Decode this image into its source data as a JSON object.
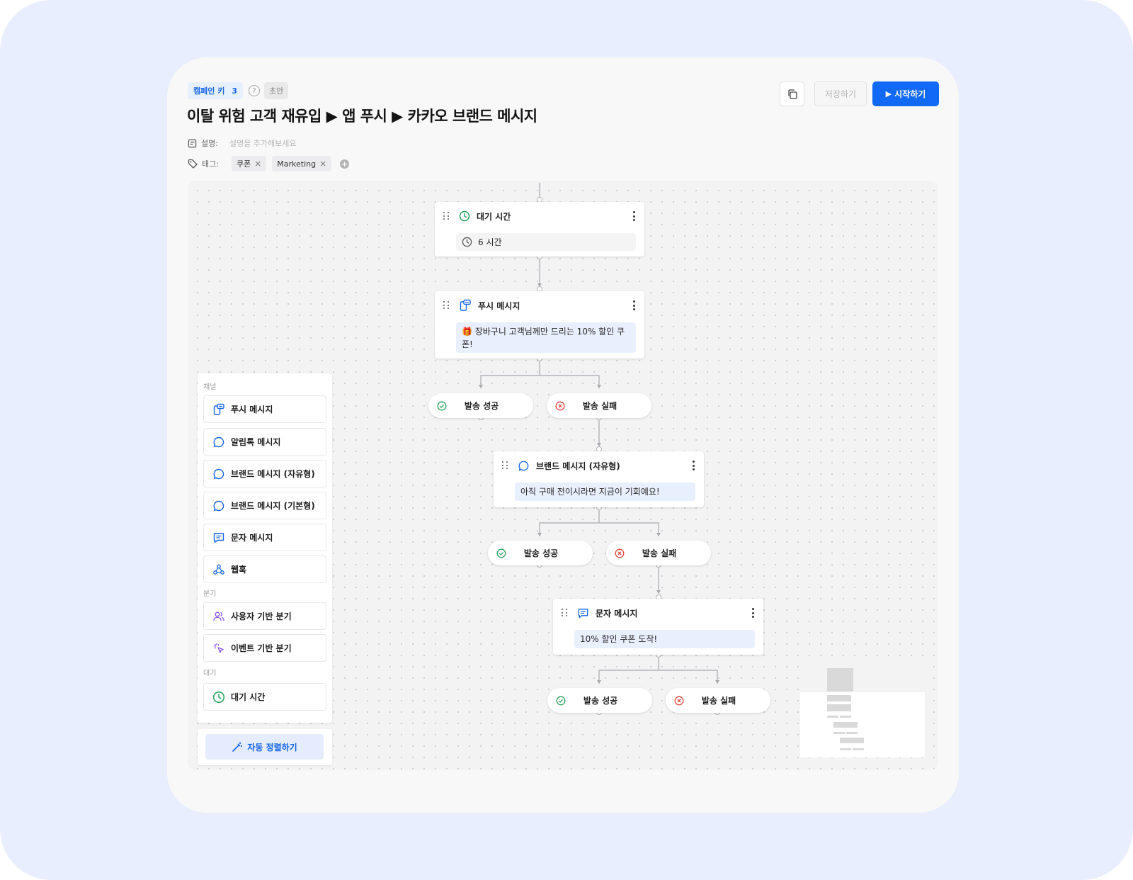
{
  "header": {
    "campaign_key_label": "캠페인 키",
    "campaign_key_value": "3",
    "help_symbol": "?",
    "status": "초안",
    "title": "이탈 위험 고객 재유입 ▶ 앱 푸시 ▶ 카카오 브랜드 메시지",
    "description_label": "설명:",
    "description_placeholder": "설명을 추가해보세요",
    "tags_label": "태그:",
    "tags": [
      "쿠폰",
      "Marketing"
    ],
    "add_tag_symbol": "+"
  },
  "toolbar": {
    "save_label": "저장하기",
    "start_label": "시작하기",
    "start_icon": "▶"
  },
  "flow": {
    "wait_node": {
      "title": "대기 시간",
      "value": "6 시간"
    },
    "push_node": {
      "title": "푸시 메시지",
      "message": "🎁 장바구니 고객님께만 드리는 10% 할인 쿠폰!"
    },
    "brand_node": {
      "title": "브랜드 메시지 (자유형)",
      "message": "아직 구매 전이시라면 지금이 기회예요!"
    },
    "sms_node": {
      "title": "문자 메시지",
      "message": "10% 할인 쿠폰 도착!"
    },
    "success_label": "발송 성공",
    "failure_label": "발송 실패"
  },
  "palette": {
    "channel_section": "채널",
    "channel_items": [
      "푸시 메시지",
      "알림톡 메시지",
      "브랜드 메시지 (자유형)",
      "브랜드 메시지 (기본형)",
      "문자 메시지",
      "웹훅"
    ],
    "branch_section": "분기",
    "branch_items": [
      "사용자 기반 분기",
      "이벤트 기반 분기"
    ],
    "wait_section": "대기",
    "wait_items": [
      "대기 시간"
    ],
    "auto_arrange_label": "자동 정렬하기"
  },
  "colors": {
    "accent": "#1169f5",
    "success": "#2aa35c",
    "failure": "#e2463a",
    "branch_icon": "#8b5cf6"
  },
  "icons": {
    "wait": "clock-icon",
    "push": "push-phone-icon",
    "kakao": "chat-bubble-icon",
    "sms": "message-icon",
    "webhook": "webhook-icon",
    "user_branch": "users-icon",
    "event_branch": "cursor-click-icon",
    "auto_arrange": "magic-wand-icon",
    "copy": "copy-icon"
  }
}
